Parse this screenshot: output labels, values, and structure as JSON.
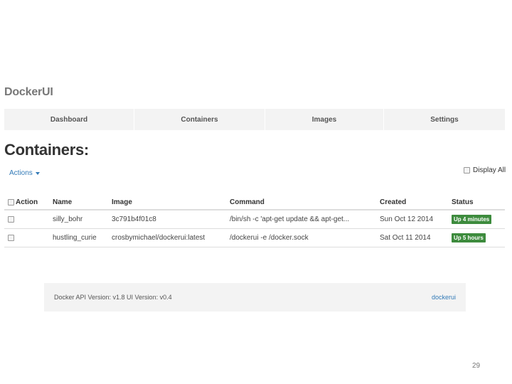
{
  "app": {
    "brand": "DockerUI"
  },
  "nav": {
    "items": [
      {
        "label": "Dashboard"
      },
      {
        "label": "Containers"
      },
      {
        "label": "Images"
      },
      {
        "label": "Settings"
      }
    ]
  },
  "page": {
    "title": "Containers:"
  },
  "toolbar": {
    "actions_label": "Actions",
    "display_all_label": "Display All"
  },
  "table": {
    "headers": {
      "action": "Action",
      "name": "Name",
      "image": "Image",
      "command": "Command",
      "created": "Created",
      "status": "Status"
    },
    "rows": [
      {
        "name": "silly_bohr",
        "image": "3c791b4f01c8",
        "command": "/bin/sh -c 'apt-get update && apt-get...",
        "created": "Sun Oct 12 2014",
        "status": "Up 4 minutes"
      },
      {
        "name": "hustling_curie",
        "image": "crosbymichael/dockerui:latest",
        "command": "/dockerui -e /docker.sock",
        "created": "Sat Oct 11 2014",
        "status": "Up 5 hours"
      }
    ]
  },
  "footer": {
    "version_text": "Docker API Version: v1.8 UI Version: v0.4",
    "link_label": "dockerui"
  },
  "slide": {
    "page_number": "29"
  },
  "colors": {
    "link": "#337ab7",
    "status_badge": "#3d8b3d",
    "navbar_bg": "#f3f3f3"
  }
}
